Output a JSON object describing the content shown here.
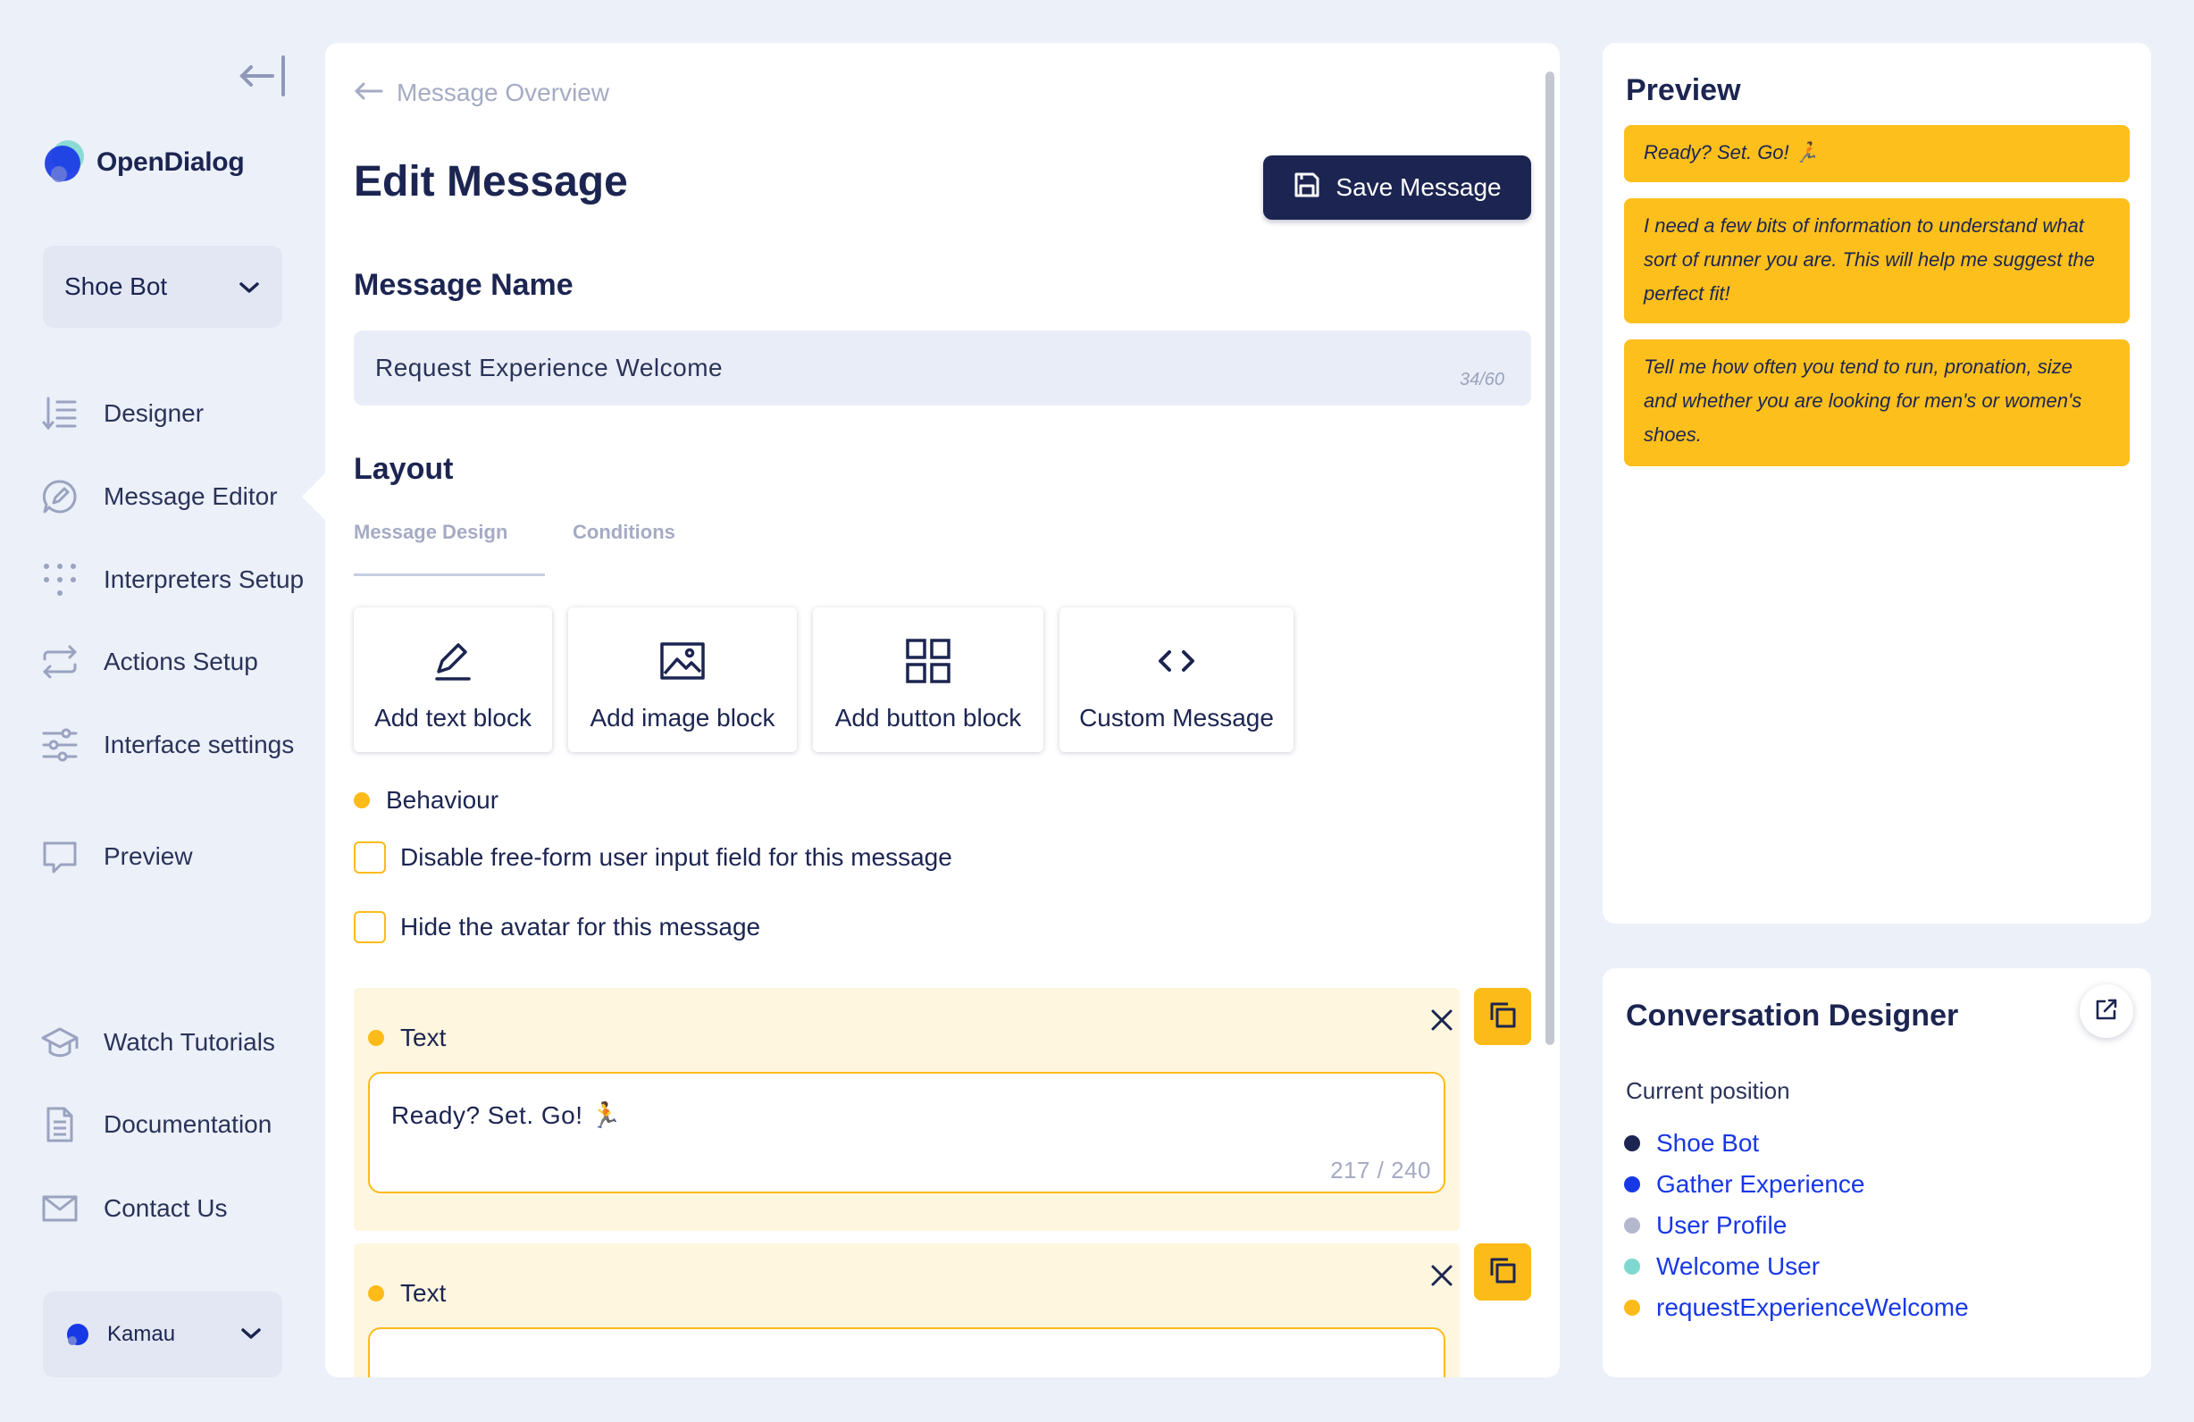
{
  "brand": {
    "name": "OpenDialog"
  },
  "sidebar": {
    "bot_select": "Shoe Bot",
    "items": [
      {
        "label": "Designer",
        "icon": "designer-icon"
      },
      {
        "label": "Message Editor",
        "icon": "message-editor-icon"
      },
      {
        "label": "Interpreters Setup",
        "icon": "interpreters-icon"
      },
      {
        "label": "Actions Setup",
        "icon": "actions-icon"
      },
      {
        "label": "Interface settings",
        "icon": "sliders-icon"
      },
      {
        "label": "Preview",
        "icon": "preview-icon"
      },
      {
        "label": "Watch Tutorials",
        "icon": "graduation-cap-icon"
      },
      {
        "label": "Documentation",
        "icon": "document-icon"
      },
      {
        "label": "Contact Us",
        "icon": "envelope-icon"
      }
    ],
    "active_item": "Message Editor",
    "user": "Kamau"
  },
  "main": {
    "breadcrumb": "Message Overview",
    "title": "Edit Message",
    "save_label": "Save Message",
    "name_heading": "Message Name",
    "name_value": "Request Experience Welcome",
    "name_count": "34/60",
    "layout_heading": "Layout",
    "tabs": [
      {
        "label": "Message Design",
        "active": true
      },
      {
        "label": "Conditions",
        "active": false
      }
    ],
    "blocks": [
      {
        "label": "Add text block",
        "icon": "pencil-icon"
      },
      {
        "label": "Add image block",
        "icon": "image-icon"
      },
      {
        "label": "Add button block",
        "icon": "grid-icon"
      },
      {
        "label": "Custom Message",
        "icon": "code-icon"
      }
    ],
    "behaviour_label": "Behaviour",
    "checkboxes": [
      {
        "label": "Disable free-form user input field for this message",
        "checked": false
      },
      {
        "label": "Hide the avatar for this message",
        "checked": false
      }
    ],
    "text_blocks": [
      {
        "label": "Text",
        "value": "Ready? Set. Go! 🏃",
        "count": "217 / 240"
      },
      {
        "label": "Text",
        "value": "",
        "count": ""
      }
    ]
  },
  "preview": {
    "title": "Preview",
    "bubbles": [
      "Ready? Set. Go! 🏃",
      "I need a few bits of information to understand what sort of runner you are. This will help me suggest the perfect fit!",
      "Tell me how often you tend to run, pronation, size and whether you are looking for men's or women's shoes."
    ]
  },
  "designer": {
    "title": "Conversation Designer",
    "current_position_label": "Current position",
    "path": [
      {
        "label": "Shoe Bot",
        "color": "#1c2551"
      },
      {
        "label": "Gather Experience",
        "color": "#1838e6"
      },
      {
        "label": "User Profile",
        "color": "#b4b8cc"
      },
      {
        "label": "Welcome User",
        "color": "#7fd8cf"
      },
      {
        "label": "requestExperienceWelcome",
        "color": "#fdbb19"
      }
    ]
  },
  "colors": {
    "accent": "#fdbb19",
    "navy": "#1c2551",
    "link": "#1838e6",
    "background": "#ecf0f9"
  }
}
